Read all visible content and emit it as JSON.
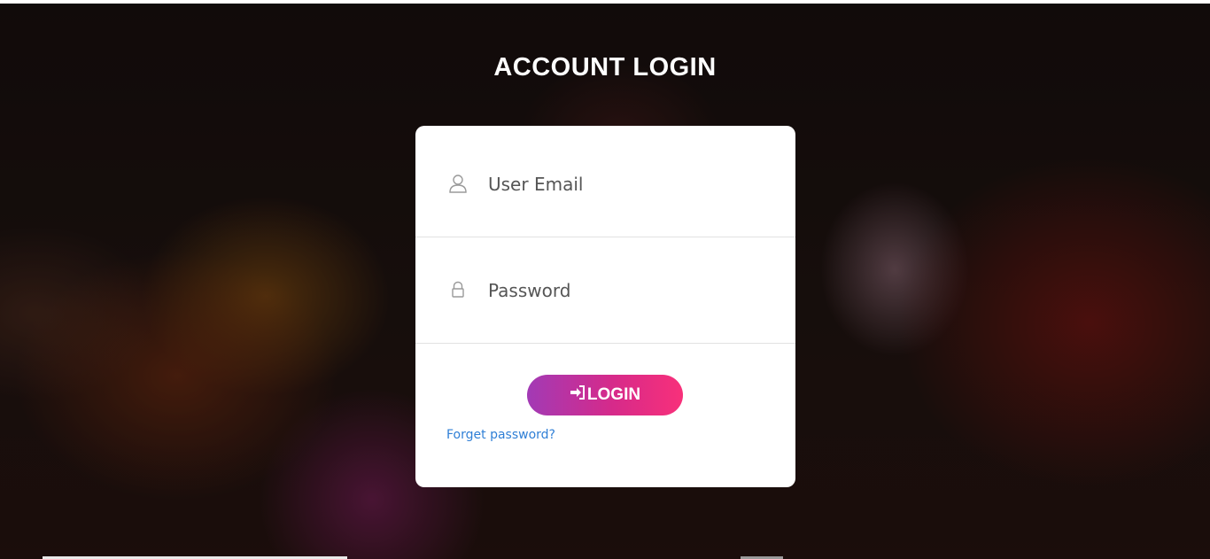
{
  "page": {
    "title": "ACCOUNT LOGIN"
  },
  "form": {
    "email": {
      "placeholder": "User Email",
      "value": "",
      "icon": "user-icon"
    },
    "password": {
      "placeholder": "Password",
      "value": "",
      "icon": "lock-icon"
    },
    "login_button": {
      "label": "LOGIN",
      "icon": "sign-in-icon"
    },
    "forgot_link": "Forget password?"
  },
  "colors": {
    "button_gradient_start": "#a23ab5",
    "button_gradient_end": "#f8307a",
    "link": "#2f7fd6",
    "card_background": "#ffffff"
  }
}
